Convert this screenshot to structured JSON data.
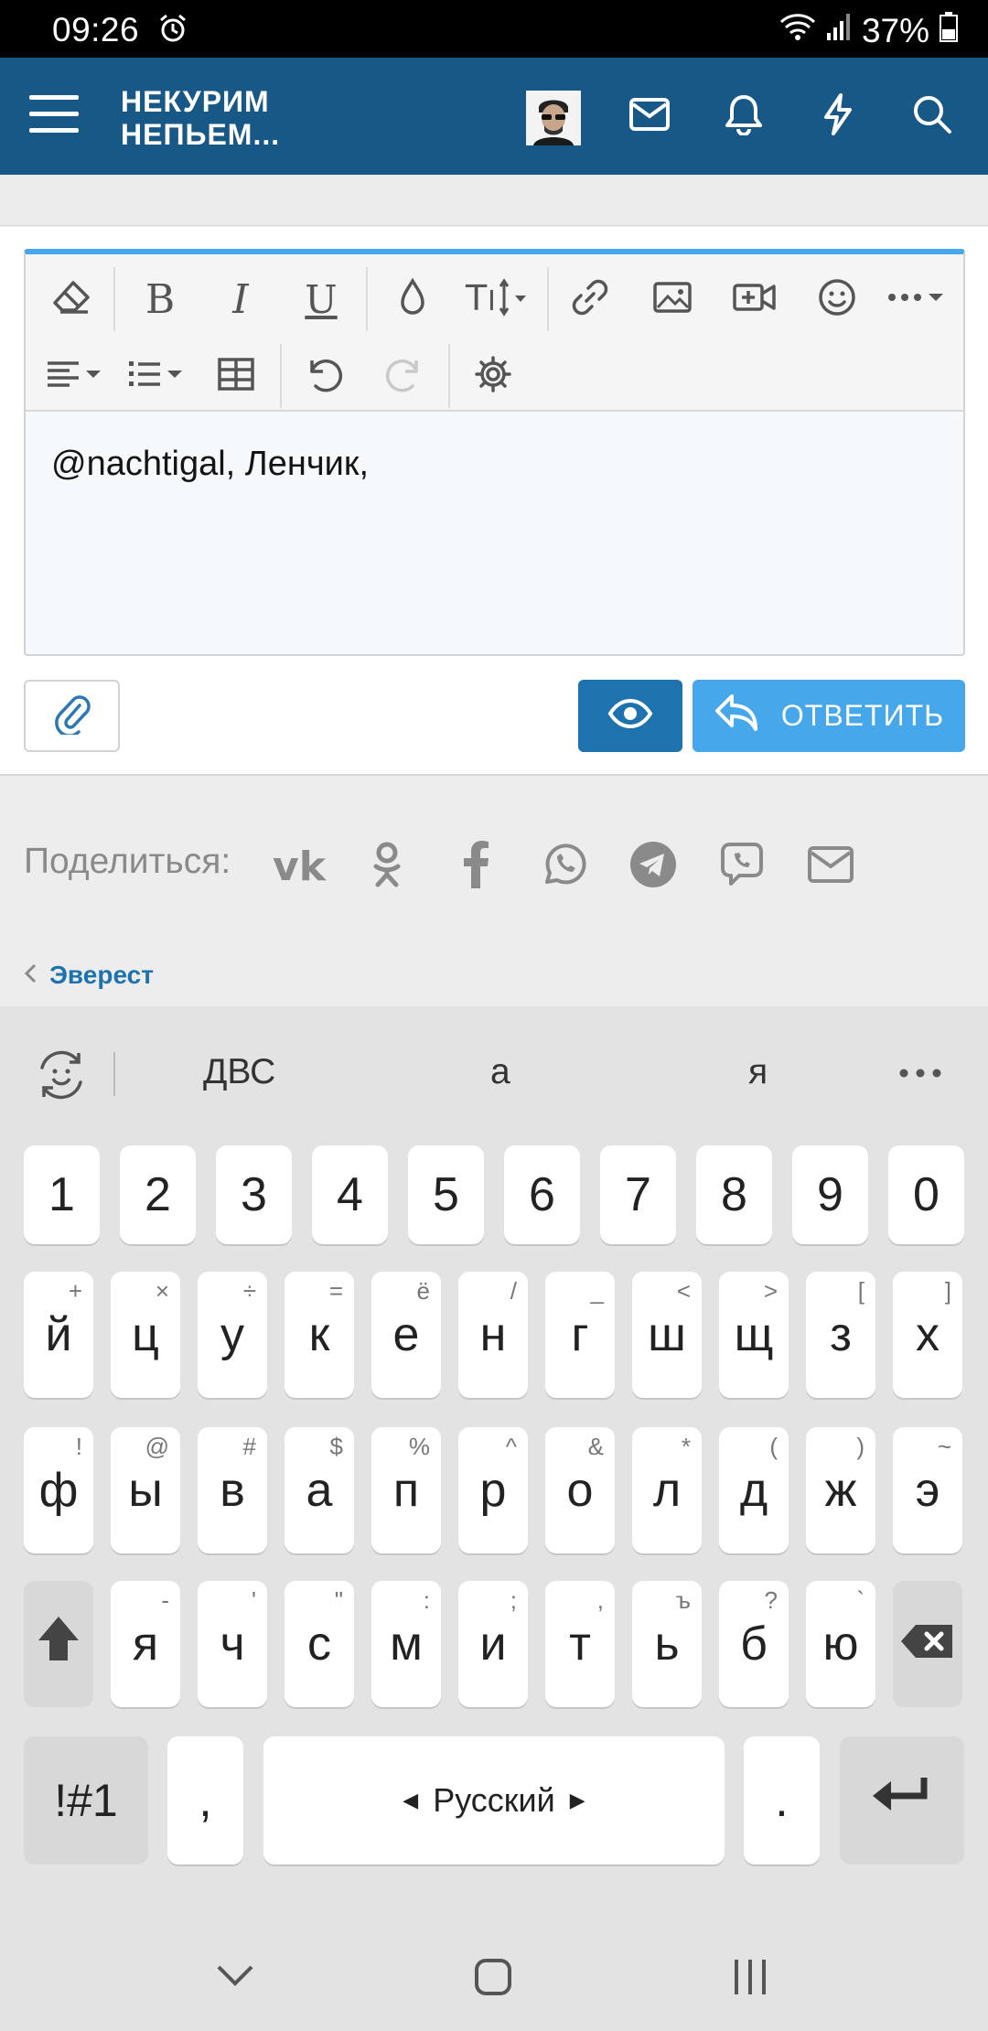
{
  "status": {
    "time": "09:26",
    "battery": "37%"
  },
  "appbar": {
    "brand_line1": "НЕКУРИМ",
    "brand_line2": "НЕПЬЕМ..."
  },
  "editor": {
    "text": "@nachtigal, Ленчик,"
  },
  "actions": {
    "reply_label": "ОТВЕТИТЬ"
  },
  "share": {
    "label": "Поделиться:",
    "services": [
      "vk",
      "odnoklassniki",
      "facebook",
      "whatsapp",
      "telegram",
      "viber",
      "email"
    ]
  },
  "breadcrumb": {
    "label": "Эверест"
  },
  "keyboard": {
    "suggestions": [
      "ДВС",
      "а",
      "я"
    ],
    "numbers": [
      "1",
      "2",
      "3",
      "4",
      "5",
      "6",
      "7",
      "8",
      "9",
      "0"
    ],
    "row1": [
      "й",
      "ц",
      "у",
      "к",
      "е",
      "н",
      "г",
      "ш",
      "щ",
      "з",
      "х"
    ],
    "row1_sub": [
      "+",
      "×",
      "÷",
      "=",
      "ё",
      "/",
      "_",
      "<",
      ">",
      "[",
      "]"
    ],
    "row2": [
      "ф",
      "ы",
      "в",
      "а",
      "п",
      "р",
      "о",
      "л",
      "д",
      "ж",
      "э"
    ],
    "row2_sub": [
      "!",
      "@",
      "#",
      "$",
      "%",
      "^",
      "&",
      "*",
      "(",
      ")",
      "~"
    ],
    "row3": [
      "я",
      "ч",
      "с",
      "м",
      "и",
      "т",
      "ь",
      "б",
      "ю"
    ],
    "row3_sub": [
      "-",
      "'",
      "\"",
      ":",
      ";",
      ",",
      "ъ",
      "?",
      "`"
    ],
    "sym_label": "!#1",
    "comma": ",",
    "space_label": "Русский",
    "period": "."
  },
  "colors": {
    "header": "#185886",
    "accent": "#47a7eb",
    "preview_button": "#1e72ae"
  }
}
